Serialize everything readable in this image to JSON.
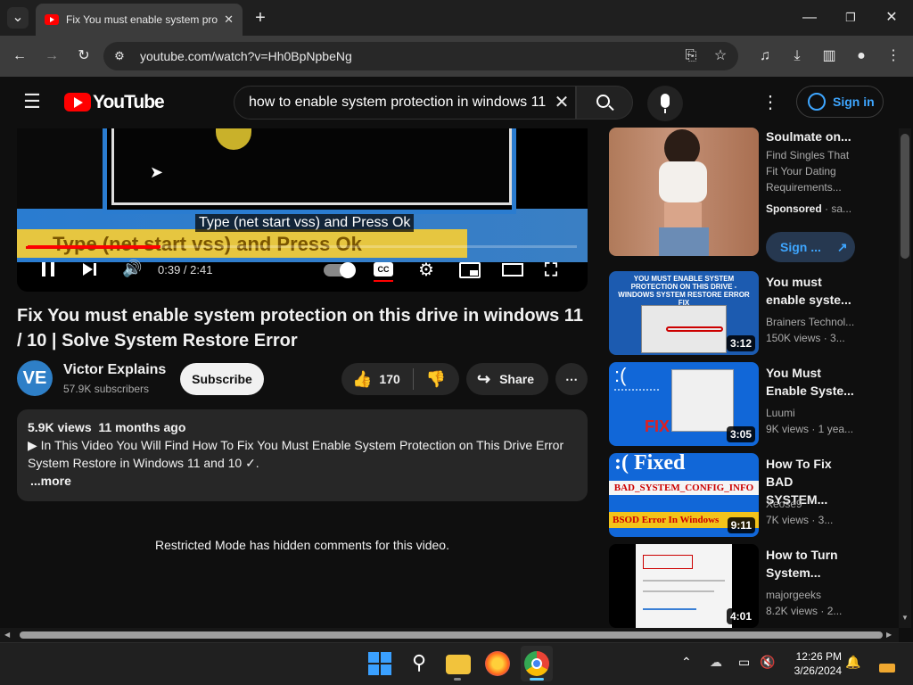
{
  "browser": {
    "tab_title": "Fix You must enable system pro",
    "url": "youtube.com/watch?v=Hh0BpNpbeNg"
  },
  "youtube": {
    "logo_text": "YouTube",
    "search_query": "how to enable system protection in windows 11",
    "signin_label": "Sign in"
  },
  "player": {
    "caption": "Type (net start vss) and Press Ok",
    "burned_text": "Type (net start vss) and Press Ok",
    "timecode": "0:39 / 2:41",
    "progress_fraction": 0.242
  },
  "video": {
    "title": "Fix You must enable system protection on this drive in windows 11 / 10 | Solve System Restore Error",
    "channel_name": "Victor Explains",
    "channel_initials": "VE",
    "subscribers": "57.9K subscribers",
    "subscribe_label": "Subscribe",
    "likes": "170",
    "share_label": "Share",
    "views": "5.9K views",
    "age": "11 months ago",
    "description": "▶ In This Video You Will Find How To Fix You Must Enable System Protection on This Drive Error System Restore in Windows 11 and 10 ✓.",
    "more_label": "...more"
  },
  "comments": {
    "restricted": "Restricted Mode has hidden comments for this video."
  },
  "sidebar": {
    "ad": {
      "title": "Soulmate on...",
      "desc": "Find Singles That Fit Your Dating Requirements...",
      "sponsored": "Sponsored",
      "sponsor_name": "· sa...",
      "cta": "Sign ..."
    },
    "recs": [
      {
        "title": "You must enable syste...",
        "channel": "Brainers Technol...",
        "meta": "150K views · 3...",
        "duration": "3:12"
      },
      {
        "title": "You Must Enable Syste...",
        "channel": "Luumi",
        "meta": "9K views · 1 yea...",
        "duration": "3:05"
      },
      {
        "title": "How To Fix BAD SYSTEM...",
        "channel": "Xeose9",
        "meta": "7K views · 3...",
        "duration": "9:11"
      },
      {
        "title": "How to Turn System...",
        "channel": "majorgeeks",
        "meta": "8.2K views · 2...",
        "duration": "4:01"
      }
    ],
    "thumb_texts": {
      "t1_header": "YOU MUST ENABLE SYSTEM PROTECTION ON THIS DRIVE - WINDOWS SYSTEM RESTORE ERROR FIX",
      "t2_fix": "FIX",
      "t3_fixed": ":( Fixed",
      "t3_code": "BAD_SYSTEM_CONFIG_INFO",
      "t3_bsod": "BSOD Error In Windows"
    }
  },
  "taskbar": {
    "time": "12:26 PM",
    "date": "3/26/2024"
  }
}
